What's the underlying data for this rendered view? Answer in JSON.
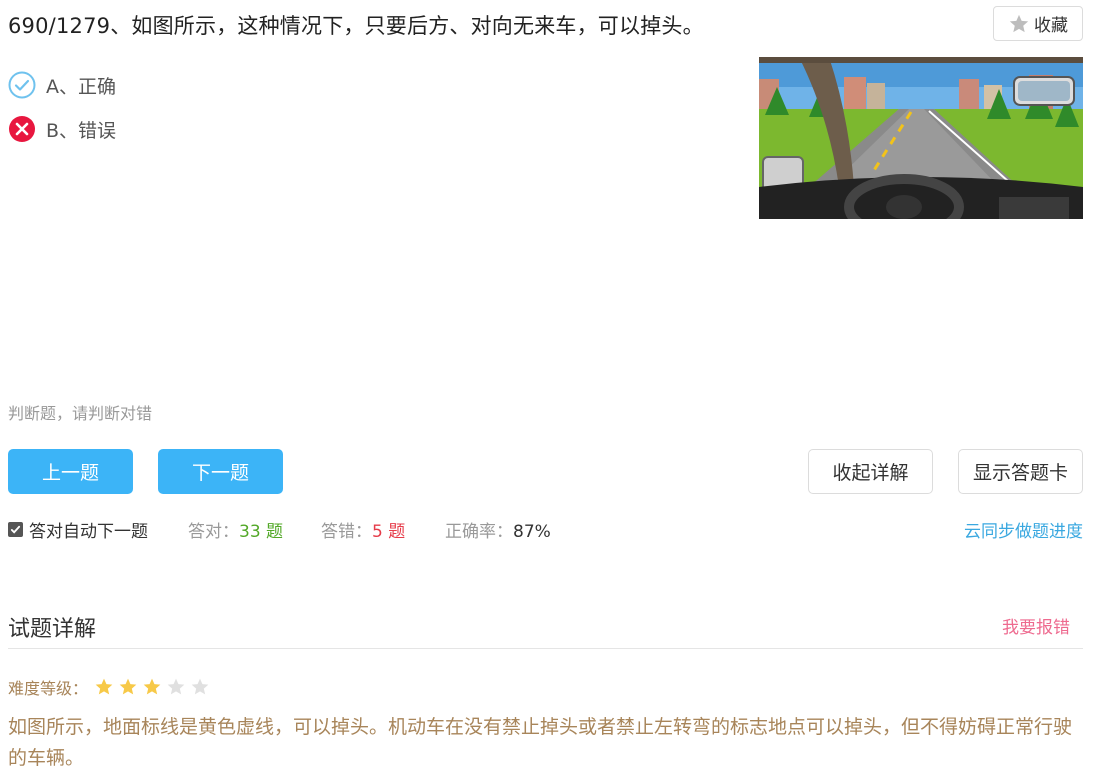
{
  "question": {
    "title": "690/1279、如图所示，这种情况下，只要后方、对向无来车，可以掉头。",
    "favorite_label": "收藏",
    "options": [
      {
        "label": "A、正确",
        "status": "correct",
        "icon": "check-circle-icon"
      },
      {
        "label": "B、错误",
        "status": "wrong",
        "icon": "x-circle-icon"
      }
    ],
    "type_hint": "判断题，请判断对错"
  },
  "buttons": {
    "prev": "上一题",
    "next": "下一题",
    "collapse": "收起详解",
    "show_card": "显示答题卡"
  },
  "stats": {
    "auto_next_label": "答对自动下一题",
    "auto_next_checked": true,
    "right_label": "答对：",
    "right_value": "33 题",
    "wrong_label": "答错：",
    "wrong_value": "5 题",
    "rate_label": "正确率：",
    "rate_value": "87%",
    "sync_label": "云同步做题进度"
  },
  "detail": {
    "title": "试题详解",
    "report_label": "我要报错",
    "difficulty_label": "难度等级：",
    "difficulty_stars": 3,
    "difficulty_max": 5,
    "explanation": "如图所示，地面标线是黄色虚线，可以掉头。机动车在没有禁止掉头或者禁止左转弯的标志地点可以掉头，但不得妨碍正常行驶的车辆。"
  },
  "colors": {
    "primary_button": "#3cb4f7",
    "correct": "#52a827",
    "wrong": "#e63c4a",
    "link": "#3aa8e0",
    "report": "#ee6a8f",
    "explain_text": "#a8855a",
    "star_on": "#f7c948",
    "star_off": "#e0e0e0"
  }
}
